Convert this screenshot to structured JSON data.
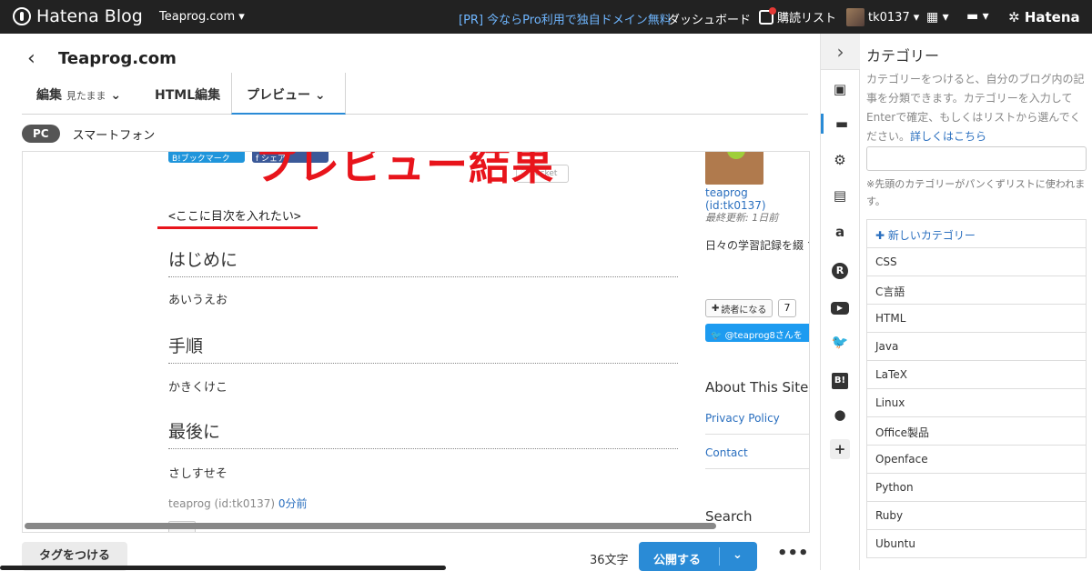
{
  "topbar": {
    "brand": "Hatena Blog",
    "blog_selector": "Teaprog.com",
    "promo": "[PR] 今ならPro利用で独自ドメイン無料",
    "dashboard": "ダッシュボード",
    "reading_list": "購読リスト",
    "user": "tk0137",
    "hatena": "Hatena"
  },
  "editor": {
    "blog_title": "Teaprog.com",
    "tabs": [
      {
        "label": "編集",
        "sub": "見たまま"
      },
      {
        "label": "HTML編集"
      },
      {
        "label": "プレビュー"
      }
    ],
    "device_modes": [
      "PC",
      "スマートフォン"
    ]
  },
  "preview": {
    "overlay_title": "プレビュー結果",
    "share_buttons": [
      "B!ブックマーク",
      "f シェア"
    ],
    "toc_note": "<ここに目次を入れたい>",
    "sections": [
      {
        "heading": "はじめに",
        "body": "あいうえお"
      },
      {
        "heading": "手順",
        "body": "かきくけこ"
      },
      {
        "heading": "最後に",
        "body": "さしすせそ"
      }
    ],
    "author_meta": "teaprog (id:tk0137)",
    "posted_ago": "0分前",
    "sidebar": {
      "author": "teaprog (id:tk0137)",
      "updated_label": "最終更新:",
      "updated_value": "1日前",
      "description": "日々の学習記録を綴 す。ティータイムの もごゆっくりどうぞ",
      "follow_label": "読者になる",
      "follow_count": "7",
      "twitter_label": "@teaprog8さんを",
      "about_title": "About This Site",
      "links": [
        "Privacy Policy",
        "Contact"
      ],
      "search_title": "Search"
    }
  },
  "footer": {
    "tag_button": "タグをつける",
    "char_count": "36文字",
    "publish_button": "公開する"
  },
  "category_panel": {
    "title": "カテゴリー",
    "description": "カテゴリーをつけると、自分のブログ内の記事を分類できます。カテゴリーを入力してEnterで確定、もしくはリストから選んでください。",
    "details_link": "詳しくはこちら",
    "note": "※先頭のカテゴリーがパンくずリストに使われます。",
    "new_category": "新しいカテゴリー",
    "categories": [
      "CSS",
      "C言語",
      "HTML",
      "Java",
      "LaTeX",
      "Linux",
      "Office製品",
      "Openface",
      "Python",
      "Ruby",
      "Ubuntu"
    ]
  },
  "tools": [
    "image-icon",
    "folder-icon",
    "gear-icon",
    "document-icon",
    "amazon-icon",
    "r-icon",
    "youtube-icon",
    "twitter-icon",
    "bookmark-icon",
    "github-icon",
    "plus-icon"
  ],
  "colors": {
    "accent": "#2a8bd6",
    "overlay_red": "#e8141b",
    "topbar": "#222222"
  }
}
